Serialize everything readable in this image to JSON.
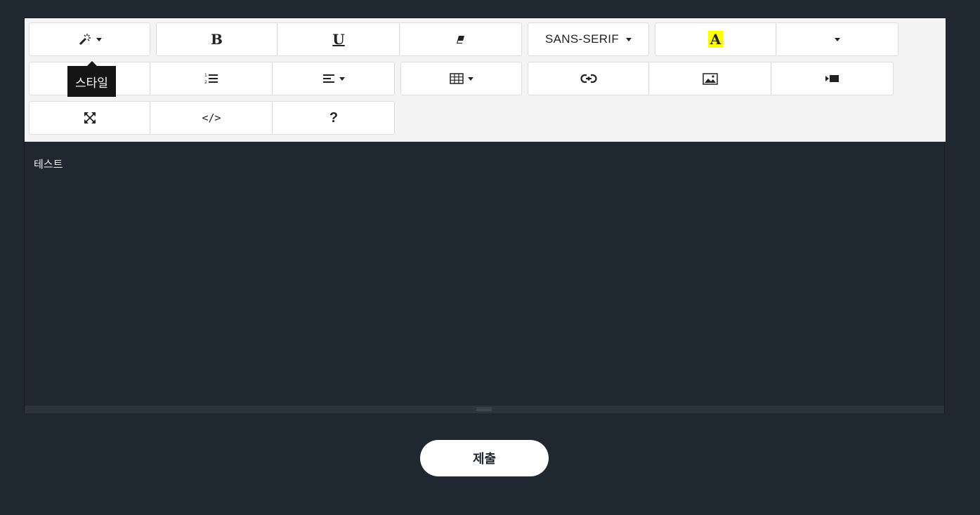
{
  "toolbar": {
    "style_tooltip": "스타일",
    "bold_glyph": "B",
    "underline_glyph": "U",
    "font_name": "SANS-SERIF",
    "highlight_glyph": "A",
    "codeview_glyph": "</>",
    "help_glyph": "?"
  },
  "editor": {
    "content": "테스트"
  },
  "submit_label": "제출",
  "colors": {
    "page_bg": "#1f2731",
    "toolbar_bg": "#f4f4f4",
    "highlight": "#ffff00"
  }
}
